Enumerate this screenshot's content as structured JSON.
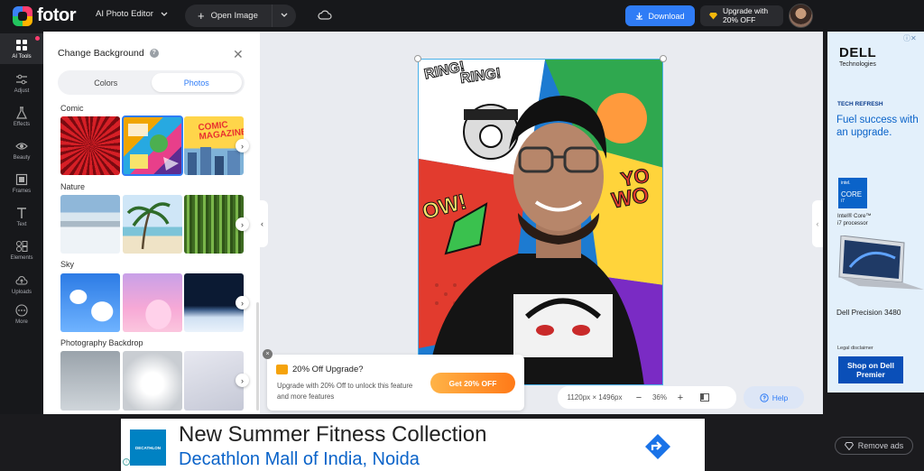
{
  "app": {
    "logo_text": "fotor",
    "editor_menu": "AI Photo Editor",
    "open_image": "Open Image",
    "download": "Download",
    "upgrade_line1": "Upgrade with",
    "upgrade_line2": "20% OFF"
  },
  "rail": {
    "items": [
      {
        "label": "AI Tools",
        "icon": "grid-icon"
      },
      {
        "label": "Adjust",
        "icon": "sliders-icon"
      },
      {
        "label": "Effects",
        "icon": "flask-icon"
      },
      {
        "label": "Beauty",
        "icon": "eye-icon"
      },
      {
        "label": "Frames",
        "icon": "frame-icon"
      },
      {
        "label": "Text",
        "icon": "text-icon"
      },
      {
        "label": "Elements",
        "icon": "shapes-icon"
      },
      {
        "label": "Uploads",
        "icon": "upload-icon"
      },
      {
        "label": "More",
        "icon": "more-icon"
      }
    ]
  },
  "panel": {
    "title": "Change Background",
    "tabs": [
      "Colors",
      "Photos"
    ],
    "active_tab": "Photos",
    "categories": [
      "Comic",
      "Nature",
      "Sky",
      "Photography Backdrop"
    ],
    "comic_thumb_text": "COMIC MAGAZINE!"
  },
  "photo_text": {
    "ring1": "RING!",
    "ring2": "RING!",
    "pow": "OW!",
    "wow": "WO",
    "yo": "YO"
  },
  "promo": {
    "title": "20% Off Upgrade?",
    "text": "Upgrade with 20% Off to unlock this feature and more features",
    "button": "Get 20% OFF",
    "close": "×"
  },
  "zoom": {
    "size": "1120px × 1496px",
    "minus": "−",
    "percent": "36%",
    "plus": "+"
  },
  "help": "Help",
  "ad_right": {
    "brand": "DELL",
    "brand_sub": "Technologies",
    "kicker": "TECH REFRESH",
    "headline": "Fuel success with an upgrade.",
    "chip_top": "intel.",
    "chip_main": "CORE",
    "chip_num": "i7",
    "processor_line1": "Intel® Core™",
    "processor_line2": "i7 processor",
    "model": "Dell Precision 3480",
    "legal": "Legal disclaimer",
    "cta": "Shop on Dell Premier"
  },
  "ad_bottom": {
    "logo": "DECATHLON",
    "title": "New Summer Fitness Collection",
    "subtitle": "Decathlon Mall of India, Noida",
    "info": "i"
  },
  "remove_ads": "Remove ads",
  "colors": {
    "accent": "#2f7cf6",
    "brand_pink": "#ff3d6e",
    "promo_orange": "#ff7a18"
  }
}
